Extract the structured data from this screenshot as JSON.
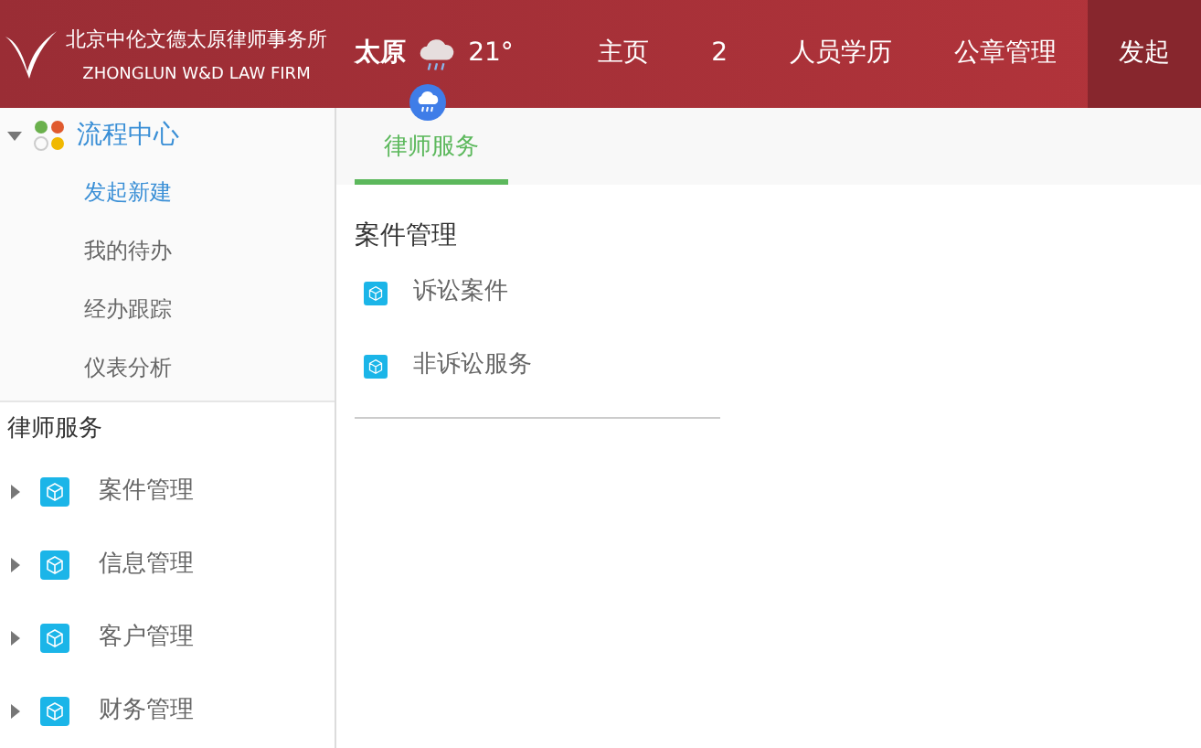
{
  "header": {
    "firm_name": "北京中伦文德太原律师事务所",
    "firm_name_en": "ZHONGLUN W&D LAW FIRM",
    "weather": {
      "city": "太原",
      "temperature": "21°"
    },
    "nav": [
      {
        "label": "主页",
        "selected": false
      },
      {
        "label": "2",
        "selected": false
      },
      {
        "label": "人员学历",
        "selected": false
      },
      {
        "label": "公章管理",
        "selected": false
      },
      {
        "label": "发起",
        "selected": true
      }
    ]
  },
  "sidebar": {
    "workflow": {
      "label": "流程中心",
      "expanded": true,
      "children": [
        {
          "label": "发起新建",
          "selected": true
        },
        {
          "label": "我的待办",
          "selected": false
        },
        {
          "label": "经办跟踪",
          "selected": false
        },
        {
          "label": "仪表分析",
          "selected": false
        }
      ]
    },
    "section_title": "律师服务",
    "groups": [
      {
        "label": "案件管理",
        "expanded": false
      },
      {
        "label": "信息管理",
        "expanded": false
      },
      {
        "label": "客户管理",
        "expanded": false
      },
      {
        "label": "财务管理",
        "expanded": false
      }
    ]
  },
  "content": {
    "tabs": [
      {
        "label": "律师服务",
        "selected": true
      }
    ],
    "heading": "案件管理",
    "items": [
      "诉讼案件",
      "非诉讼服务"
    ]
  }
}
